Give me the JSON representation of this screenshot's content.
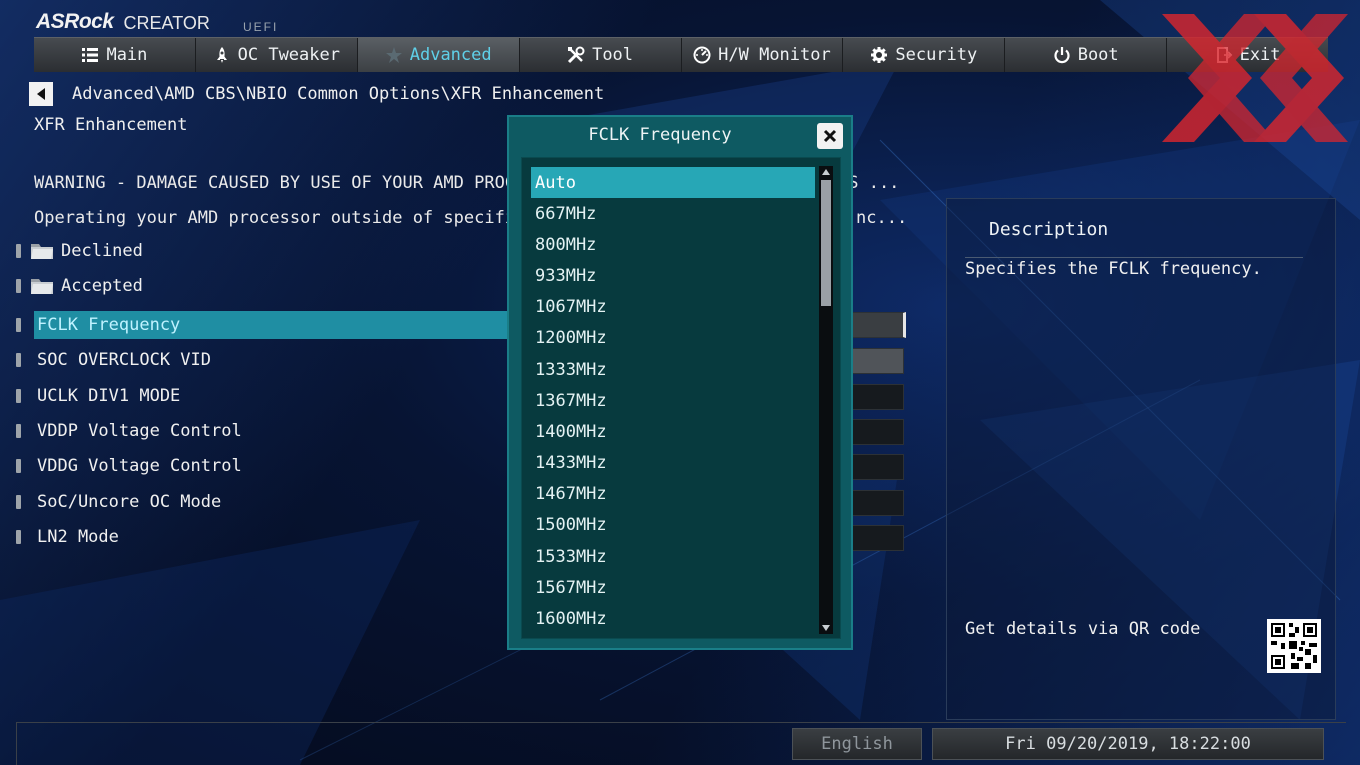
{
  "header": {
    "brand": "ASRock",
    "product": "CREATOR",
    "uefi": "UEFI"
  },
  "nav": {
    "tabs": [
      {
        "label": "Main",
        "icon": "list-icon"
      },
      {
        "label": "OC Tweaker",
        "icon": "rocket-icon"
      },
      {
        "label": "Advanced",
        "icon": "star-icon",
        "active": true
      },
      {
        "label": "Tool",
        "icon": "tools-icon"
      },
      {
        "label": "H/W Monitor",
        "icon": "monitor-icon"
      },
      {
        "label": "Security",
        "icon": "shield-gear-icon"
      },
      {
        "label": "Boot",
        "icon": "power-icon"
      },
      {
        "label": "Exit",
        "icon": "exit-icon"
      }
    ]
  },
  "breadcrumb": "Advanced\\AMD CBS\\NBIO Common Options\\XFR Enhancement",
  "section_title": "XFR Enhancement",
  "warnings": {
    "line1_left": "WARNING - DAMAGE CAUSED BY USE OF YOUR AMD PROCESSOR",
    "line1_right": "SS ...",
    "line2_left": "Operating your AMD processor outside of specificatio",
    "line2_right": "nc..."
  },
  "options": [
    {
      "label": "Declined",
      "type": "folder"
    },
    {
      "label": "Accepted",
      "type": "folder"
    },
    {
      "label": "FCLK Frequency",
      "type": "setting",
      "selected": true
    },
    {
      "label": "SOC OVERCLOCK VID",
      "type": "setting"
    },
    {
      "label": "UCLK DIV1 MODE",
      "type": "setting"
    },
    {
      "label": "VDDP Voltage Control",
      "type": "setting"
    },
    {
      "label": "VDDG Voltage Control",
      "type": "setting"
    },
    {
      "label": "SoC/Uncore OC Mode",
      "type": "setting"
    },
    {
      "label": "LN2 Mode",
      "type": "setting"
    }
  ],
  "popup": {
    "title": "FCLK Frequency",
    "items": [
      "Auto",
      "667MHz",
      "800MHz",
      "933MHz",
      "1067MHz",
      "1200MHz",
      "1333MHz",
      "1367MHz",
      "1400MHz",
      "1433MHz",
      "1467MHz",
      "1500MHz",
      "1533MHz",
      "1567MHz",
      "1600MHz"
    ],
    "selected_index": 0
  },
  "description": {
    "title": "Description",
    "text": "Specifies the FCLK frequency.",
    "qr_text": "Get details via QR code"
  },
  "footer": {
    "language": "English",
    "datetime": "Fri 09/20/2019, 18:22:00"
  },
  "colors": {
    "accent": "#5fd0e8",
    "selection": "#1f8ea3",
    "popup_bg": "#0e5a62",
    "popup_selection": "#27a7b6",
    "watermark": "#d8262e"
  }
}
